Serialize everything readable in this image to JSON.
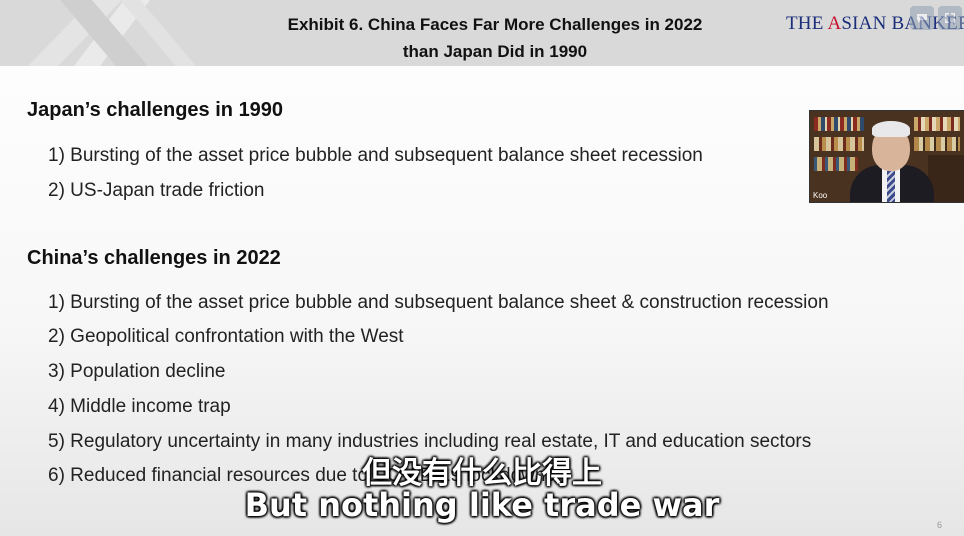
{
  "header": {
    "title_line1": "Exhibit 6. China Faces Far More Challenges in 2022",
    "title_line2": "than Japan Did in 1990",
    "brand_prefix": "THE ",
    "brand_accent": "A",
    "brand_suffix": "SIAN BANKER",
    "brand_color": "#1b2e7a",
    "brand_accent_color": "#c8102e"
  },
  "corner_icons": [
    "chat-icon",
    "expand-icon"
  ],
  "japan": {
    "heading": "Japan’s challenges in 1990",
    "items": [
      "1) Bursting of the asset price bubble and subsequent balance sheet recession",
      "2) US-Japan trade friction"
    ]
  },
  "china": {
    "heading": "China’s challenges in 2022",
    "items": [
      "1) Bursting of the asset price bubble and subsequent balance sheet & construction recession",
      "2) Geopolitical confrontation with the West",
      "3) Population decline",
      "4) Middle income trap",
      "5) Regulatory uncertainty in many industries including real estate, IT and education sectors",
      "6) Reduced financial resources due to COVID-19 lockdowns"
    ]
  },
  "video": {
    "label": "Koo"
  },
  "subtitles": {
    "chinese": "但没有什么比得上",
    "english": "But nothing like trade war"
  },
  "page_number": "6"
}
